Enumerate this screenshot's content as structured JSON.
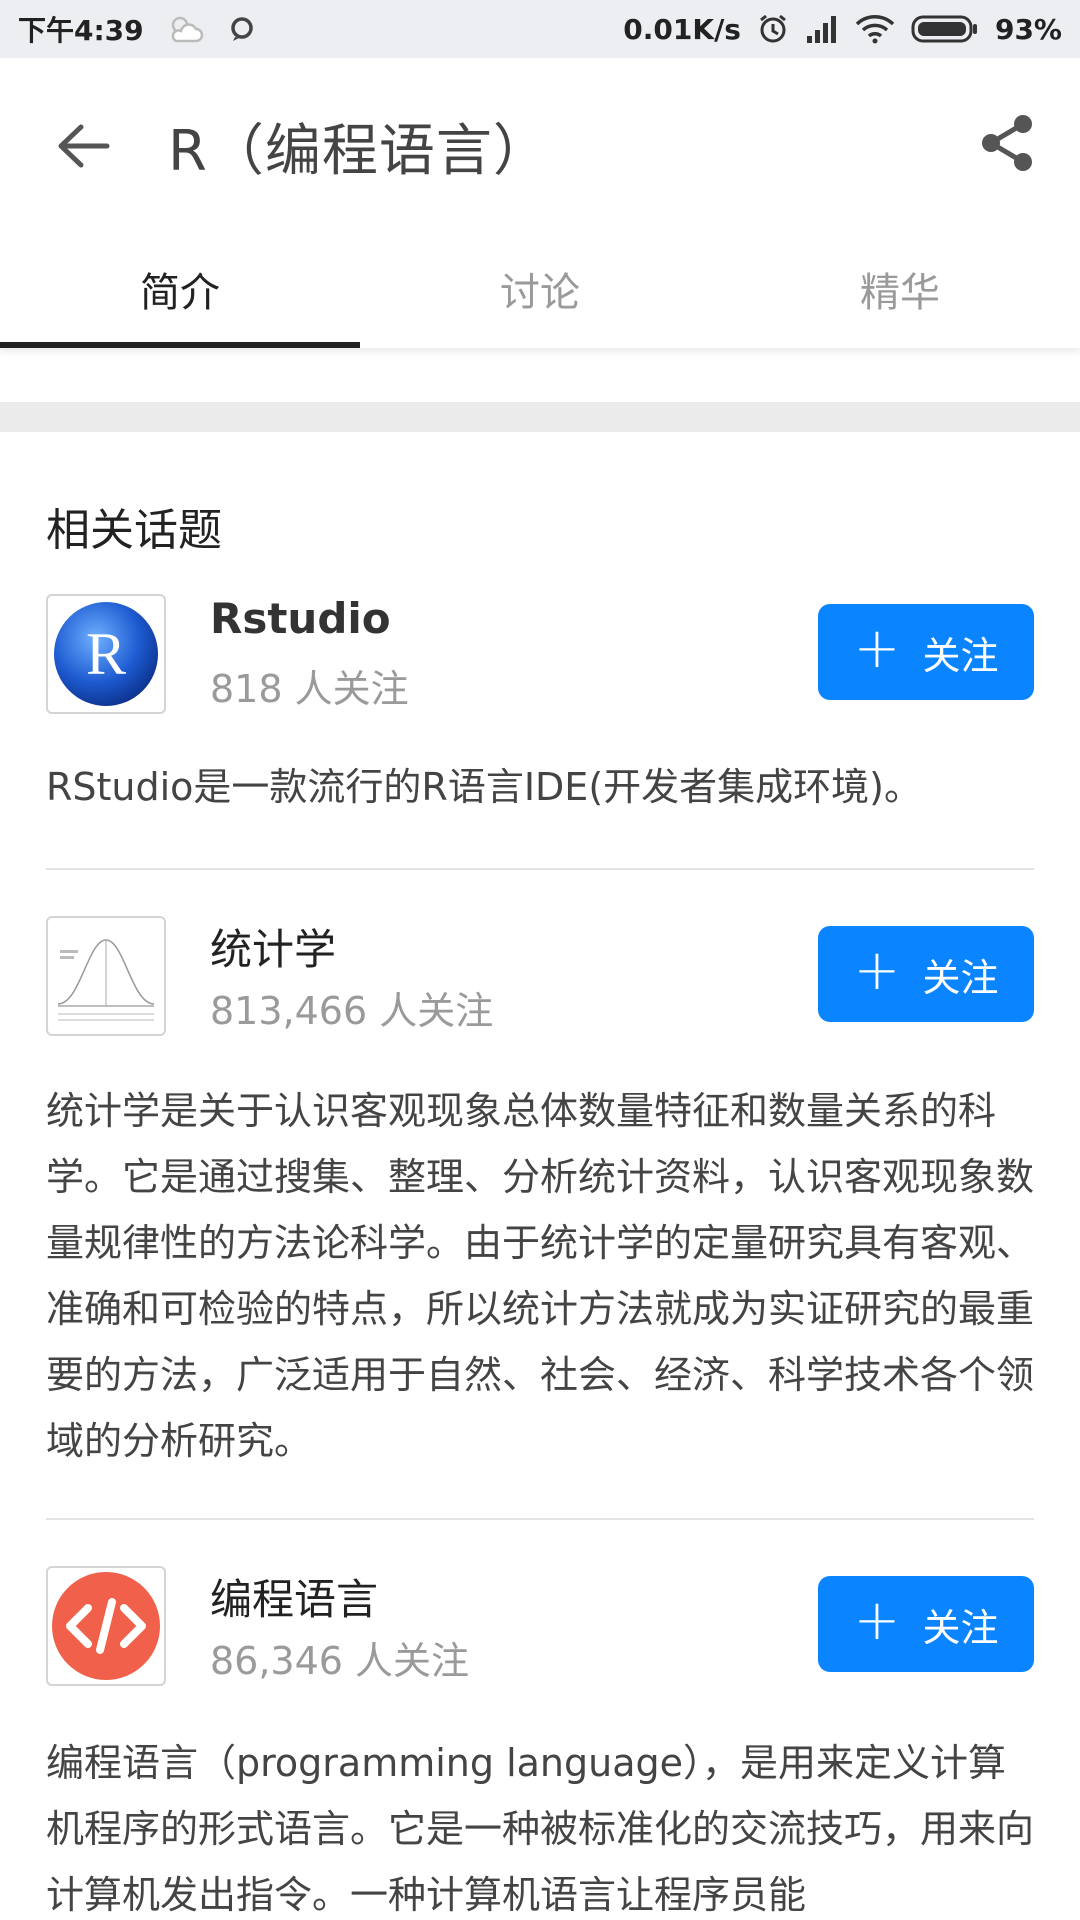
{
  "status_bar": {
    "time": "下午4:39",
    "net_speed": "0.01K/s",
    "battery": "93%"
  },
  "toolbar": {
    "title": "R（编程语言）"
  },
  "tabs": [
    {
      "label": "简介",
      "active": true
    },
    {
      "label": "讨论",
      "active": false
    },
    {
      "label": "精华",
      "active": false
    }
  ],
  "section": {
    "title": "相关话题"
  },
  "topics": [
    {
      "name": "Rstudio",
      "followers": "818 人关注",
      "follow_label": "关注",
      "desc": "RStudio是一款流行的R语言IDE(开发者集成环境)。"
    },
    {
      "name": "统计学",
      "followers": "813,466 人关注",
      "follow_label": "关注",
      "desc": "统计学是关于认识客观现象总体数量特征和数量关系的科学。它是通过搜集、整理、分析统计资料，认识客观现象数量规律性的方法论科学。由于统计学的定量研究具有客观、准确和可检验的特点，所以统计方法就成为实证研究的最重要的方法，广泛适用于自然、社会、经济、科学技术各个领域的分析研究。"
    },
    {
      "name": "编程语言",
      "followers": "86,346 人关注",
      "follow_label": "关注",
      "desc": "编程语言（programming language），是用来定义计算机程序的形式语言。它是一种被标准化的交流技巧，用来向计算机发出指令。一种计算机语言让程序员能"
    }
  ],
  "colors": {
    "accent": "#0a84ff",
    "code_icon_bg": "#f0604a",
    "r_logo_blue": "#1e5bd1"
  }
}
